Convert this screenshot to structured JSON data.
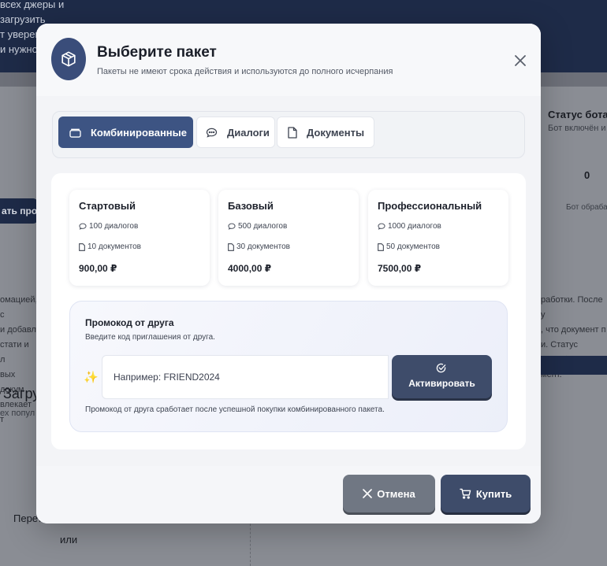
{
  "background": {
    "header_text": "всех джеры и загрузить\nт уверенно отвечать и\nи нужно б",
    "left_button_label": "ать про",
    "status_title": "Статус бота",
    "status_subtitle": "Бот включён и",
    "stat_value": "0",
    "bot_text": "Бот обраба",
    "left_paragraph": "омацией, с\nи добавл\nстати и л\nвых докум\nвлекает т",
    "right_paragraph": "работки. После у\n, что документ п\nи. Статус \"Ошибк\nмент.",
    "left_title": "Загру",
    "left_subtitle": "ех попул",
    "drop_text": "Перет",
    "or_text": "или"
  },
  "modal": {
    "title": "Выберите пакет",
    "subtitle": "Пакеты не имеют срока действия и используются до полного исчерпания",
    "header_icon": "box-icon",
    "tabs": [
      {
        "label": "Комбинированные",
        "icon": "wallet-icon",
        "active": true
      },
      {
        "label": "Диалоги",
        "icon": "chat-icon",
        "active": false
      },
      {
        "label": "Документы",
        "icon": "document-icon",
        "active": false
      }
    ],
    "plans": [
      {
        "name": "Стартовый",
        "dialogs": "100 диалогов",
        "documents": "10 документов",
        "price": "900,00 ₽"
      },
      {
        "name": "Базовый",
        "dialogs": "500 диалогов",
        "documents": "30 документов",
        "price": "4000,00 ₽"
      },
      {
        "name": "Профессиональный",
        "dialogs": "1000 диалогов",
        "documents": "50 документов",
        "price": "7500,00 ₽"
      }
    ],
    "promo": {
      "title": "Промокод от друга",
      "subtitle": "Введите код приглашения от друга.",
      "placeholder": "Например: FRIEND2024",
      "value": "",
      "activate_label": "Активировать",
      "note": "Промокод от друга сработает после успешной покупки комбинированного пакета."
    },
    "footer": {
      "cancel_label": "Отмена",
      "buy_label": "Купить"
    },
    "colors": {
      "accent": "#3d5483",
      "button_dark": "#3e4c6a",
      "button_cancel": "#707783",
      "sparkle": "#f0b429"
    }
  }
}
